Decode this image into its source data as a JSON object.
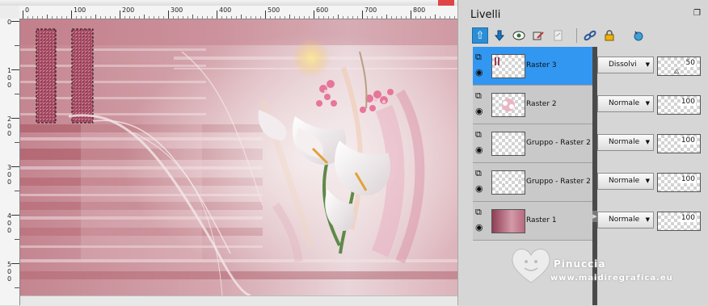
{
  "canvas": {
    "ruler_top_labels": [
      "0",
      "100",
      "200",
      "300",
      "400",
      "500",
      "600",
      "700",
      "800"
    ],
    "ruler_left_labels": [
      "0",
      "100",
      "200",
      "300",
      "400",
      "500"
    ]
  },
  "panel": {
    "title": "Livelli",
    "toolbar_icons": [
      "new-layer-up-icon",
      "new-layer-down-icon",
      "mask-icon",
      "eyedropper-icon",
      "copy-icon",
      "link-icon",
      "lock-icon",
      "refresh-icon"
    ],
    "layers": [
      {
        "name": "Raster 3",
        "blend": "Dissolvi",
        "opacity": "50",
        "selected": true,
        "thumb": "raster3"
      },
      {
        "name": "Raster 2",
        "blend": "Normale",
        "opacity": "100",
        "selected": false,
        "thumb": "flowers"
      },
      {
        "name": "Gruppo - Raster 2",
        "blend": "Normale",
        "opacity": "100",
        "selected": false,
        "thumb": "empty"
      },
      {
        "name": "Gruppo - Raster 2",
        "blend": "Normale",
        "opacity": "100",
        "selected": false,
        "thumb": "dots"
      },
      {
        "name": "Raster 1",
        "blend": "Normale",
        "opacity": "100",
        "selected": false,
        "thumb": "pink"
      }
    ]
  },
  "watermark": {
    "name": "Pinuccia",
    "url": "www.maidiregrafica.eu"
  },
  "colors": {
    "selection_blue": "#3297f0",
    "canvas_pink": "#c9838f",
    "dark_rose": "#9a4a5e"
  }
}
